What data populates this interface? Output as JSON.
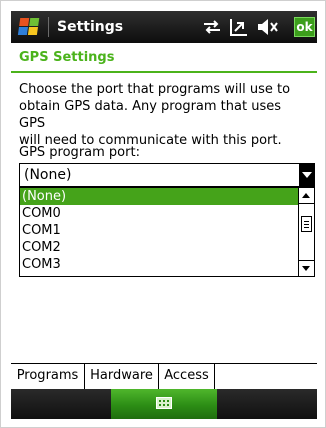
{
  "titlebar": {
    "title": "Settings",
    "ok_label": "ok",
    "icons": [
      "windows-start-icon",
      "connectivity-icon",
      "signal-off-icon",
      "volume-muted-icon"
    ]
  },
  "header": {
    "title": "GPS Settings"
  },
  "main": {
    "description": [
      "Choose the port that programs will use to",
      "obtain GPS data. Any program that uses GPS",
      "will need to communicate with this port."
    ],
    "port_label": "GPS program port:",
    "port_value": "(None)",
    "port_options": [
      "(None)",
      "COM0",
      "COM1",
      "COM2",
      "COM3"
    ],
    "selected_index": 0
  },
  "tabs": [
    {
      "label": "Programs",
      "active": true
    },
    {
      "label": "Hardware",
      "active": false
    },
    {
      "label": "Access",
      "active": false
    }
  ],
  "menubar": {
    "icon": "keyboard-icon"
  },
  "colors": {
    "accent": "#4bb31b",
    "selection": "#45a31a",
    "titlebar": "#1a1a1a"
  }
}
